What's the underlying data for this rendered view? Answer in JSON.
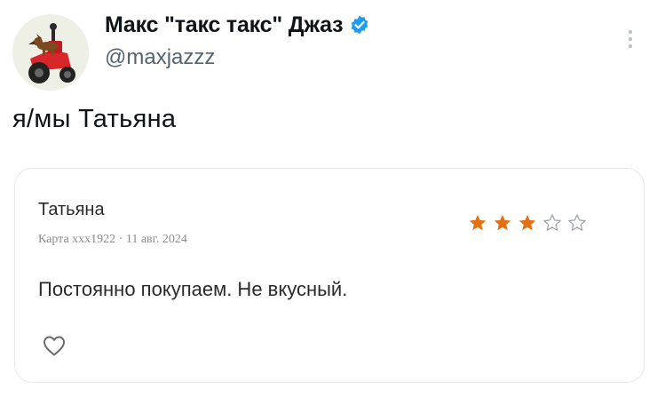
{
  "tweet": {
    "author": {
      "display_name": "Макс \"такс такс\" Джаз",
      "handle": "@maxjazzz",
      "verified": true,
      "avatar_icon": "dachshund-on-red-tractor-avatar"
    },
    "more_icon": "more-vertical-icon",
    "text": "я/мы Татьяна"
  },
  "review_card": {
    "author": "Татьяна",
    "meta": "Карта ххх1922 · 11 авг. 2024",
    "rating": 3,
    "max_rating": 5,
    "text": "Постоянно покупаем. Не вкусный.",
    "like_icon": "heart-outline-icon"
  },
  "colors": {
    "verified_blue": "#1d9bf0",
    "star_filled": "#e36f13",
    "star_empty": "#9aa0a6",
    "handle_gray": "#536471",
    "card_border": "#e6e9ec"
  }
}
